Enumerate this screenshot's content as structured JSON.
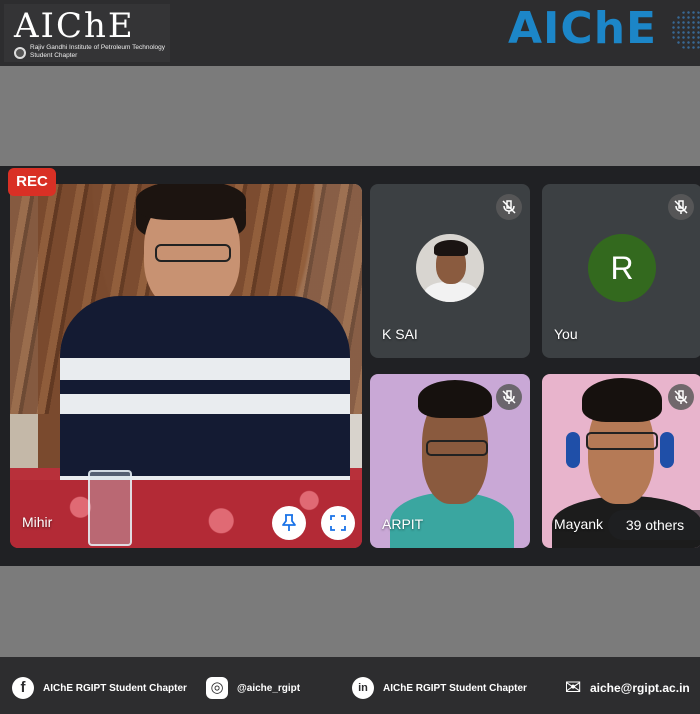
{
  "header": {
    "logo_left": {
      "name": "AIChE",
      "subtitle_line1": "Rajiv Gandhi Institute of Petroleum Technology",
      "subtitle_line2": "Student Chapter"
    },
    "logo_right": {
      "name": "AIChE"
    }
  },
  "meeting": {
    "rec_label": "REC",
    "main_participant": {
      "name": "Mihir",
      "pin_icon": "pin-icon",
      "fullscreen_icon": "fullscreen-icon"
    },
    "participants": [
      {
        "name": "K SAI",
        "muted": true,
        "avatar": "photo"
      },
      {
        "name": "You",
        "muted": true,
        "avatar": "letter",
        "letter": "R",
        "avatar_color": "#33691e"
      },
      {
        "name": "ARPIT",
        "muted": true,
        "avatar": "video"
      },
      {
        "name": "Mayank",
        "muted": true,
        "avatar": "video"
      }
    ],
    "others_label": "39 others",
    "rec_color": "#d93025"
  },
  "footer": {
    "items": [
      {
        "icon": "facebook-icon",
        "glyph": "f",
        "text": "AIChE RGIPT Student Chapter"
      },
      {
        "icon": "instagram-icon",
        "glyph": "◎",
        "text": "@aiche_rgipt"
      },
      {
        "icon": "linkedin-icon",
        "glyph": "in",
        "text": "AIChE RGIPT Student Chapter"
      },
      {
        "icon": "mail-icon",
        "glyph": "✉",
        "text": "aiche@rgipt.ac.in"
      }
    ]
  },
  "colors": {
    "brand_blue": "#1c86c8",
    "meet_bg": "#202124",
    "tile_bg": "#3c4043"
  }
}
